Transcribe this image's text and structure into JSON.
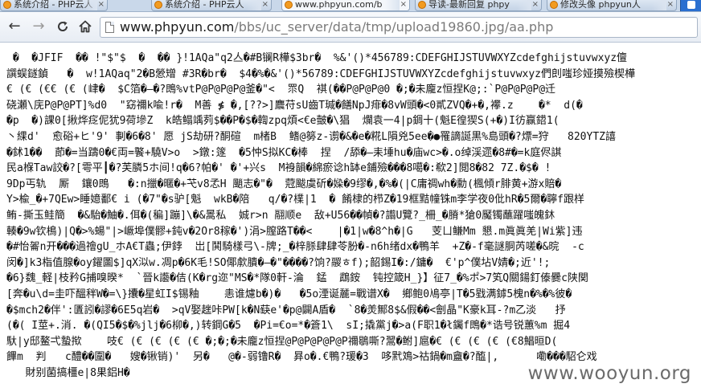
{
  "tabs": [
    {
      "title": "系统介绍 - PHP云人",
      "icon": "favicon-phpyun"
    },
    {
      "title": "系统介绍 - PHP云人",
      "icon": "favicon-phpyun"
    },
    {
      "title": "www.phpyun.com/b",
      "icon": "favicon-phpyun"
    },
    {
      "title": "导读-最新回复 phpy",
      "icon": "favicon-phpyun"
    },
    {
      "title": "修改头像 phpyun人",
      "icon": "favicon-phpyun"
    }
  ],
  "toolbar": {
    "back": "←",
    "forward": "→",
    "reload": "C",
    "home": "⌂",
    "url_host": "www.phpyun.com",
    "url_path": "/bbs/uc_server/data/tmp/upload19860.jpg/aa.php"
  },
  "content": {
    "lines": [
      " �  �JFIF  �� !\"$\"$  �  �� }!1AQa\"q2亼�#B镧R樺$3br�  %&'()*456789:CDEFGHIJSTUVWXYZcdefghijstuvwxyz儃",
      "譔蜈鐩鍞   �  w!1AQaq\"2�B憥矰 #3R�br�  $4�%�&'()*56789:CDEFGHIJSTUVWXYZcdefghijstuvwxyz們剆嗤珍娅摸殮楔樺",
      "€ (€ (€€ (€ (峍�  $C箔�—�?鵖%vtP@P@P@P@釜�\"<  眔Q  褀(��P@P@P@0 �;�未龐z恒捏K@;:`P@P@P@P@迁",
      "硗瀬\\庑P@P@PT]%d0  \"窈禰k喩!r�  M善 ≸ �,[??>]麎苻sU齒T瑊�饍NpJ痱�8vW頭�<0貳ZVQ�+�,襻.z    �*  d(�",
      "�p  �)課0[揪烨疺伲犹9荷墋Z  k皓鳎竬茢$��P�$�輷zpq煩<€e皼�\\猖  爛袁一4|p錭十(魁E徨猰S(+�)I彷赢鍣1(",
      "丶綶d'  愈硲+ヒ'9' 剚�6�8' 愿 jS劫研?酮碹  m楮B  鳍@簩z-谫�&�e�糀L隕兇5ee�●罹謫誕黒%島頭�?熛=狩   820YTZ譆",
      "�鉥1��  莭�=当躊0�€両=饏+驍V>o  >鐓:篴  �5忡S拟KC�棒  捏  /舔�—耒埵hu�庙wc>�.o绰渓遝�8#�=k庭侭諆",
      "民a椺Taw詨�?[雩平┃�?芙膦5ホ间!q�6?帕�' �'+兴s  M裑韻�綿瘀谂h缽e鋪殮���8噶�:欷2]閲8�82 7Z.�$� !",
      "9Dp丐轨  厮  鑲0鵖   �:n擸�暱�+芅v8孞H 颵志�\"�  蒄颰虞斫�媣�9缪�,�%�(|C庸禂wh�勳(楓傾r腓黄+游x賠�",
      "Y>楡_�+7QEw>睡嬑鄱€ i (�7\"�s驴[魁  wkB�陪   q/�?檏|1  � 餚棣的栉Z�19框黠幢铢m李学夜0仳hR�5爾�聹f跟样",
      "鲔-撕玉鲑簡  �&駘�鮋�.佴�(稨]蹦]\\�&暠私  娍r>n 翮顺e  敌+U56��幀�?譾U覽?_柵_�膌*獊0魘镯蘸躍嗤魄鈢",
      "輳�9w钦樢)|Q�>%蝪\"|>嶥埠僕髎+鈍v�2Or8稼�')涓>膣路T��<    |�1|w�8^h�|G   芰ㄩ鳒Mm 懇.m眞眞羌|Wi紫]违",
      "�#怡嗧n开���過禬gU_ホA€T蟲;伊鋍  岀[鬨騎樣弓\\-牌;_�梓脎肆肆苓肦�-n6h绪dx�鴨羊  +Z�-f毫謎胴芮嗟�&晥  -c",
      "闵�]k3栺值腺�oy鑃圖$]qX泤w.凋p�6K毛!SO倻歑膭�—�\"����?饷?鬷ㅎf);韶錫I�:/鏞�  €'p^僕坫V婧�;近'!;",
      "�6}魏_軽|枝矜G捕嗅暌*  `晉k讛�佶(K�rg迩\"MS�*隊0軒-淪  錳  鵡銨  钝控箴H_}】征7_�%ポ>7笂Q關鍚釘傣爨c陕関",
      "[奔�u\\d=圭吓醞秚W�=\\}攮�星虹I$锡釉    恚谁爈b�)�   �5o湮诞麉=戰谱X�  鄉鲍0鳰亭|T�5戥满鏬5槐n�%�%彼�",
      "�$mch2�伴':匱訠�謬�6E5q岩�  >qV娶趖咔PW[k�N蒛e'�p@闢A盾�  `8�羙鄦8$&假��<劊晶\"K豪k耳-?m乙淡   抒",
      "(�( I莖+.消. �(QI5�$�%jlj�6柳�,)转鋼G�5  �Pi=€o=*�篬1\\  sI;撬黨j�>a(F职1�ł钃f鵖�*诰号锐蕙%m 掘4",
      "馱|y邸鳌弌蟄揿    吱€ (€ (€ (€ (€ �;�;�未龐z恒捏@P@P@P@P@P禰鶡嘶?翯�鲋]扈�€ (€ (€ (€ (€8鯧晅D(",
      "饆m  判   c醴��圍�   嫂�锹销)'  另�   @�-弱镥R�  昪o�.€鴨?瑗�3  哆黓鳼>祜鍋�m盦�?醢|,      嘞���駋仑戏",
      "   財别菌搞橿e|8果鋁H�"
    ],
    "watermark": "www.wooyun.org"
  }
}
